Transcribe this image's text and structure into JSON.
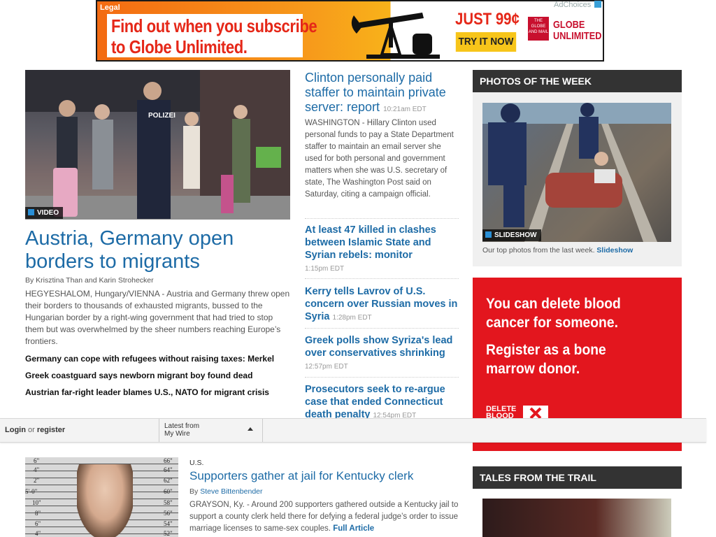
{
  "ad_banner": {
    "tag": "Legal",
    "line1": "Find out when you subscribe",
    "line2": "to Globe Unlimited.",
    "price": "JUST 99¢",
    "cta": "TRY IT NOW",
    "logo_text": "THE GLOBE AND MAIL",
    "brand_line1": "GLOBE",
    "brand_line2": "UNLIMITED",
    "adchoices": "AdChoices"
  },
  "lead_story": {
    "badge": "VIDEO",
    "image_sign": "POLIZEI",
    "title": "Austria, Germany open borders to migrants",
    "byline": "By Krisztina Than and Karin Strohecker",
    "summary": "HEGYESHALOM, Hungary/VIENNA - Austria and Germany threw open their borders to thousands of exhausted migrants, bussed to the Hungarian border by a right-wing government that had tried to stop them but was overwhelmed by the sheer numbers reaching Europe’s frontiers.",
    "related": [
      "Germany can cope with refugees without raising taxes: Merkel",
      "Greek coastguard says newborn migrant boy found dead",
      "Austrian far-right leader blames U.S., NATO for migrant crisis"
    ]
  },
  "middle_stories": {
    "top": {
      "title": "Clinton personally paid staffer to maintain private server: report",
      "time": "10:21am EDT",
      "summary": "WASHINGTON - Hillary Clinton used personal funds to pay a State Department staffer to maintain an email server she used for both personal and government matters when she was U.S. secretary of state, The Washington Post said on Saturday, citing a campaign official."
    },
    "items": [
      {
        "title": "At least 47 killed in clashes between Islamic State and Syrian rebels: monitor",
        "time": "1:15pm EDT"
      },
      {
        "title": "Kerry tells Lavrov of U.S. concern over Russian moves in Syria",
        "time": "1:28pm EDT"
      },
      {
        "title": "Greek polls show Syriza's lead over conservatives shrinking",
        "time": "12:57pm EDT"
      },
      {
        "title": "Prosecutors seek to re-argue case that ended Connecticut death penalty",
        "time": "12:54pm EDT"
      }
    ]
  },
  "photos_of_week": {
    "header": "PHOTOS OF THE WEEK",
    "badge": "SLIDESHOW",
    "caption": "Our top photos from the last week.",
    "link": "Slideshow"
  },
  "red_ad": {
    "line1": "You can delete blood",
    "line2": "cancer for someone.",
    "line3": "Register as a bone",
    "line4": "marrow donor.",
    "logo1": "DELETE",
    "logo2": "BLOOD"
  },
  "tales_from_trail": {
    "header": "TALES FROM THE TRAIL"
  },
  "bottom_bar": {
    "login": "Login",
    "or": "or",
    "register": "register",
    "wire_line1": "Latest from",
    "wire_line2": "My Wire"
  },
  "bottom_story": {
    "section": "U.S.",
    "title": "Supporters gather at jail for Kentucky clerk",
    "byline_prefix": "By",
    "author": "Steve Bittenbender",
    "summary": "GRAYSON, Ky. - Around 200 supporters gathered outside a Kentucky jail to support a county clerk held there for defying a federal judge’s order to issue marriage licenses to same-sex couples.",
    "link": "Full Article",
    "height_marks_left": [
      "6\"",
      "4\"",
      "2\"",
      "5'-0\"",
      "10\"",
      "8\"",
      "6\"",
      "4\""
    ],
    "height_marks_right": [
      "66\"",
      "64\"",
      "62\"",
      "60\"",
      "58\"",
      "56\"",
      "54\"",
      "52\""
    ]
  }
}
